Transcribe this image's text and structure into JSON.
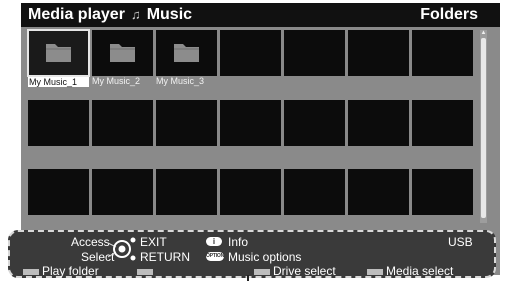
{
  "header": {
    "title": "Media player",
    "subtitle": "Music",
    "mode": "Folders"
  },
  "folders": [
    {
      "label": "My Music_1",
      "selected": true
    },
    {
      "label": "My Music_2",
      "selected": false
    },
    {
      "label": "My Music_3",
      "selected": false
    }
  ],
  "grid": {
    "rows": 3,
    "columns": 7
  },
  "help": {
    "access": "Access",
    "select": "Select",
    "exit": "EXIT",
    "return": "RETURN",
    "info": "Info",
    "info_key": "i",
    "option_key": "OPTION",
    "music_options": "Music options",
    "source": "USB",
    "play_folder": "Play folder",
    "drive_select": "Drive select",
    "media_select": "Media select"
  },
  "colors": {
    "background": "#8a8a8a",
    "header": "#111111",
    "tile": "#0c0c0c",
    "help_panel": "#3a3a3a",
    "folder": "#8c8c8c"
  }
}
